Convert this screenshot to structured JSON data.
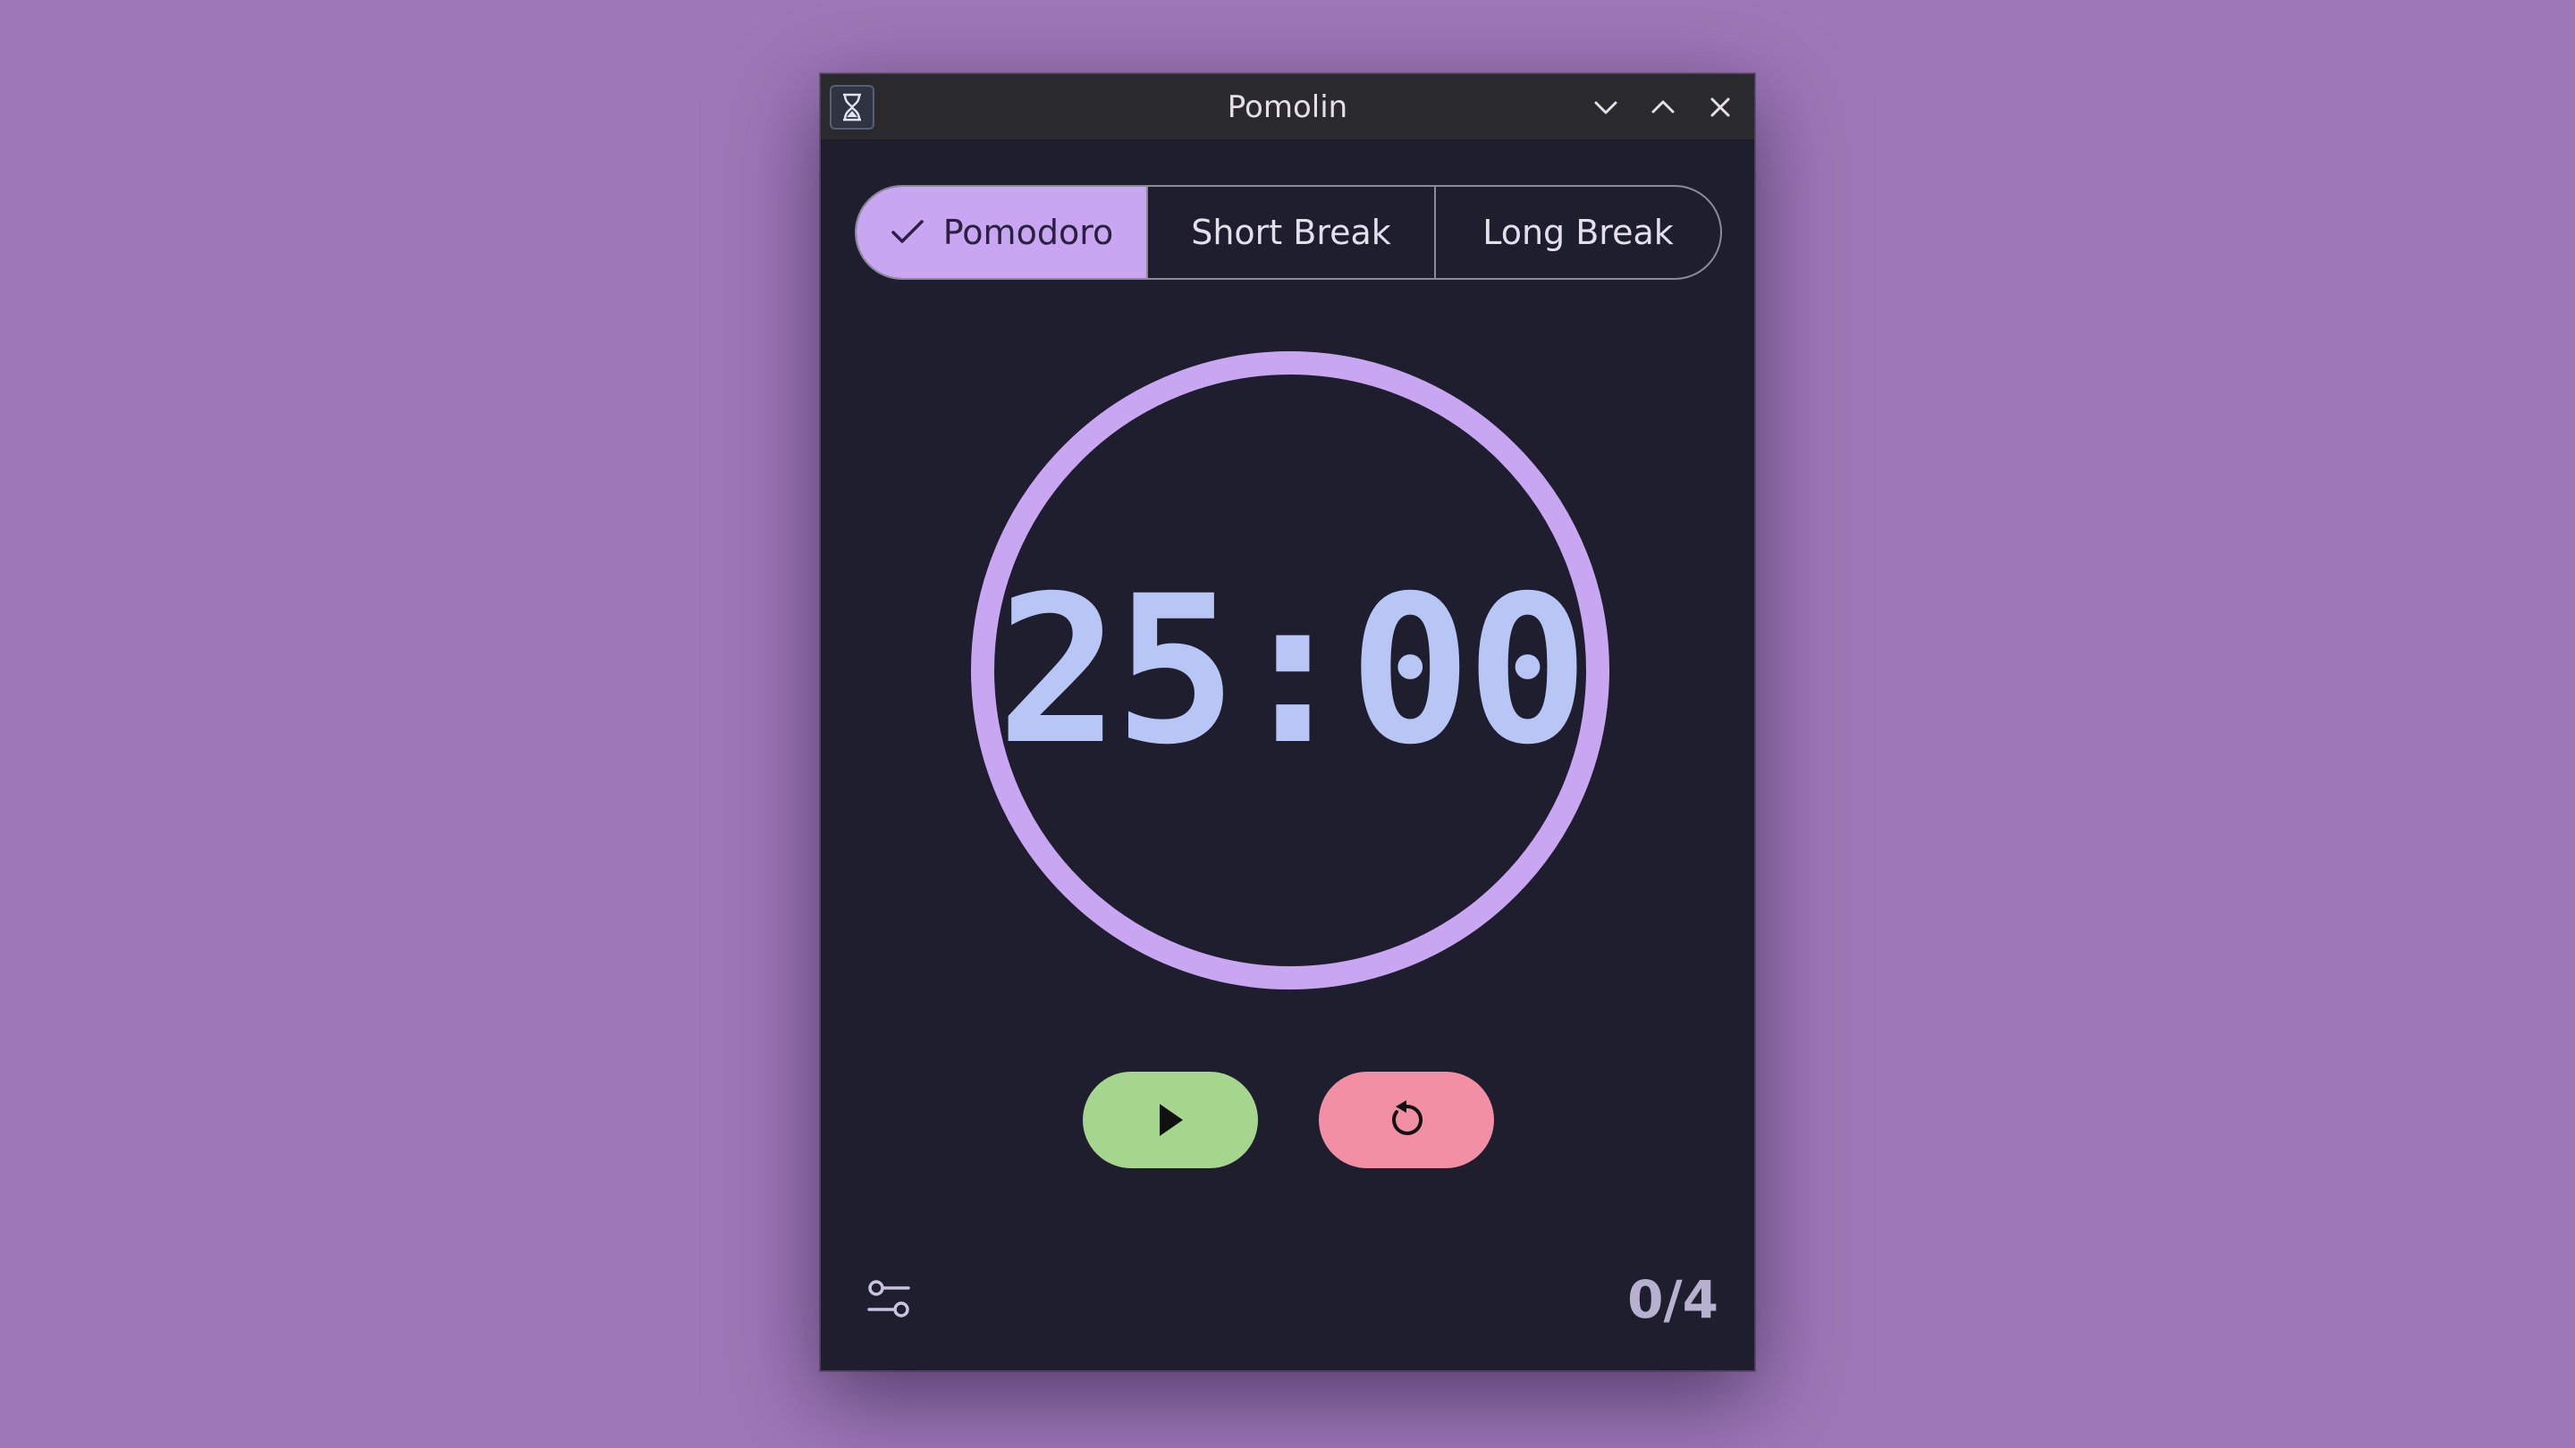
{
  "window": {
    "title": "Pomolin"
  },
  "icons": {
    "app": "hourglass-icon",
    "minimize": "chevron-down-icon",
    "maximize": "chevron-up-icon",
    "close": "close-icon",
    "check": "check-icon",
    "play": "play-icon",
    "reset": "reset-icon",
    "settings": "sliders-icon"
  },
  "modes": [
    {
      "label": "Pomodoro",
      "selected": true
    },
    {
      "label": "Short Break",
      "selected": false
    },
    {
      "label": "Long Break",
      "selected": false
    }
  ],
  "timer": {
    "display": "25:00",
    "progress": 1.0
  },
  "session": {
    "counter": "0/4"
  },
  "colors": {
    "background": "#9c78b6",
    "window": "#1e1e2e",
    "accent": "#c9a6f2",
    "timer_text": "#b8c6f6",
    "play": "#a6d58e",
    "reset": "#f28fa4"
  }
}
